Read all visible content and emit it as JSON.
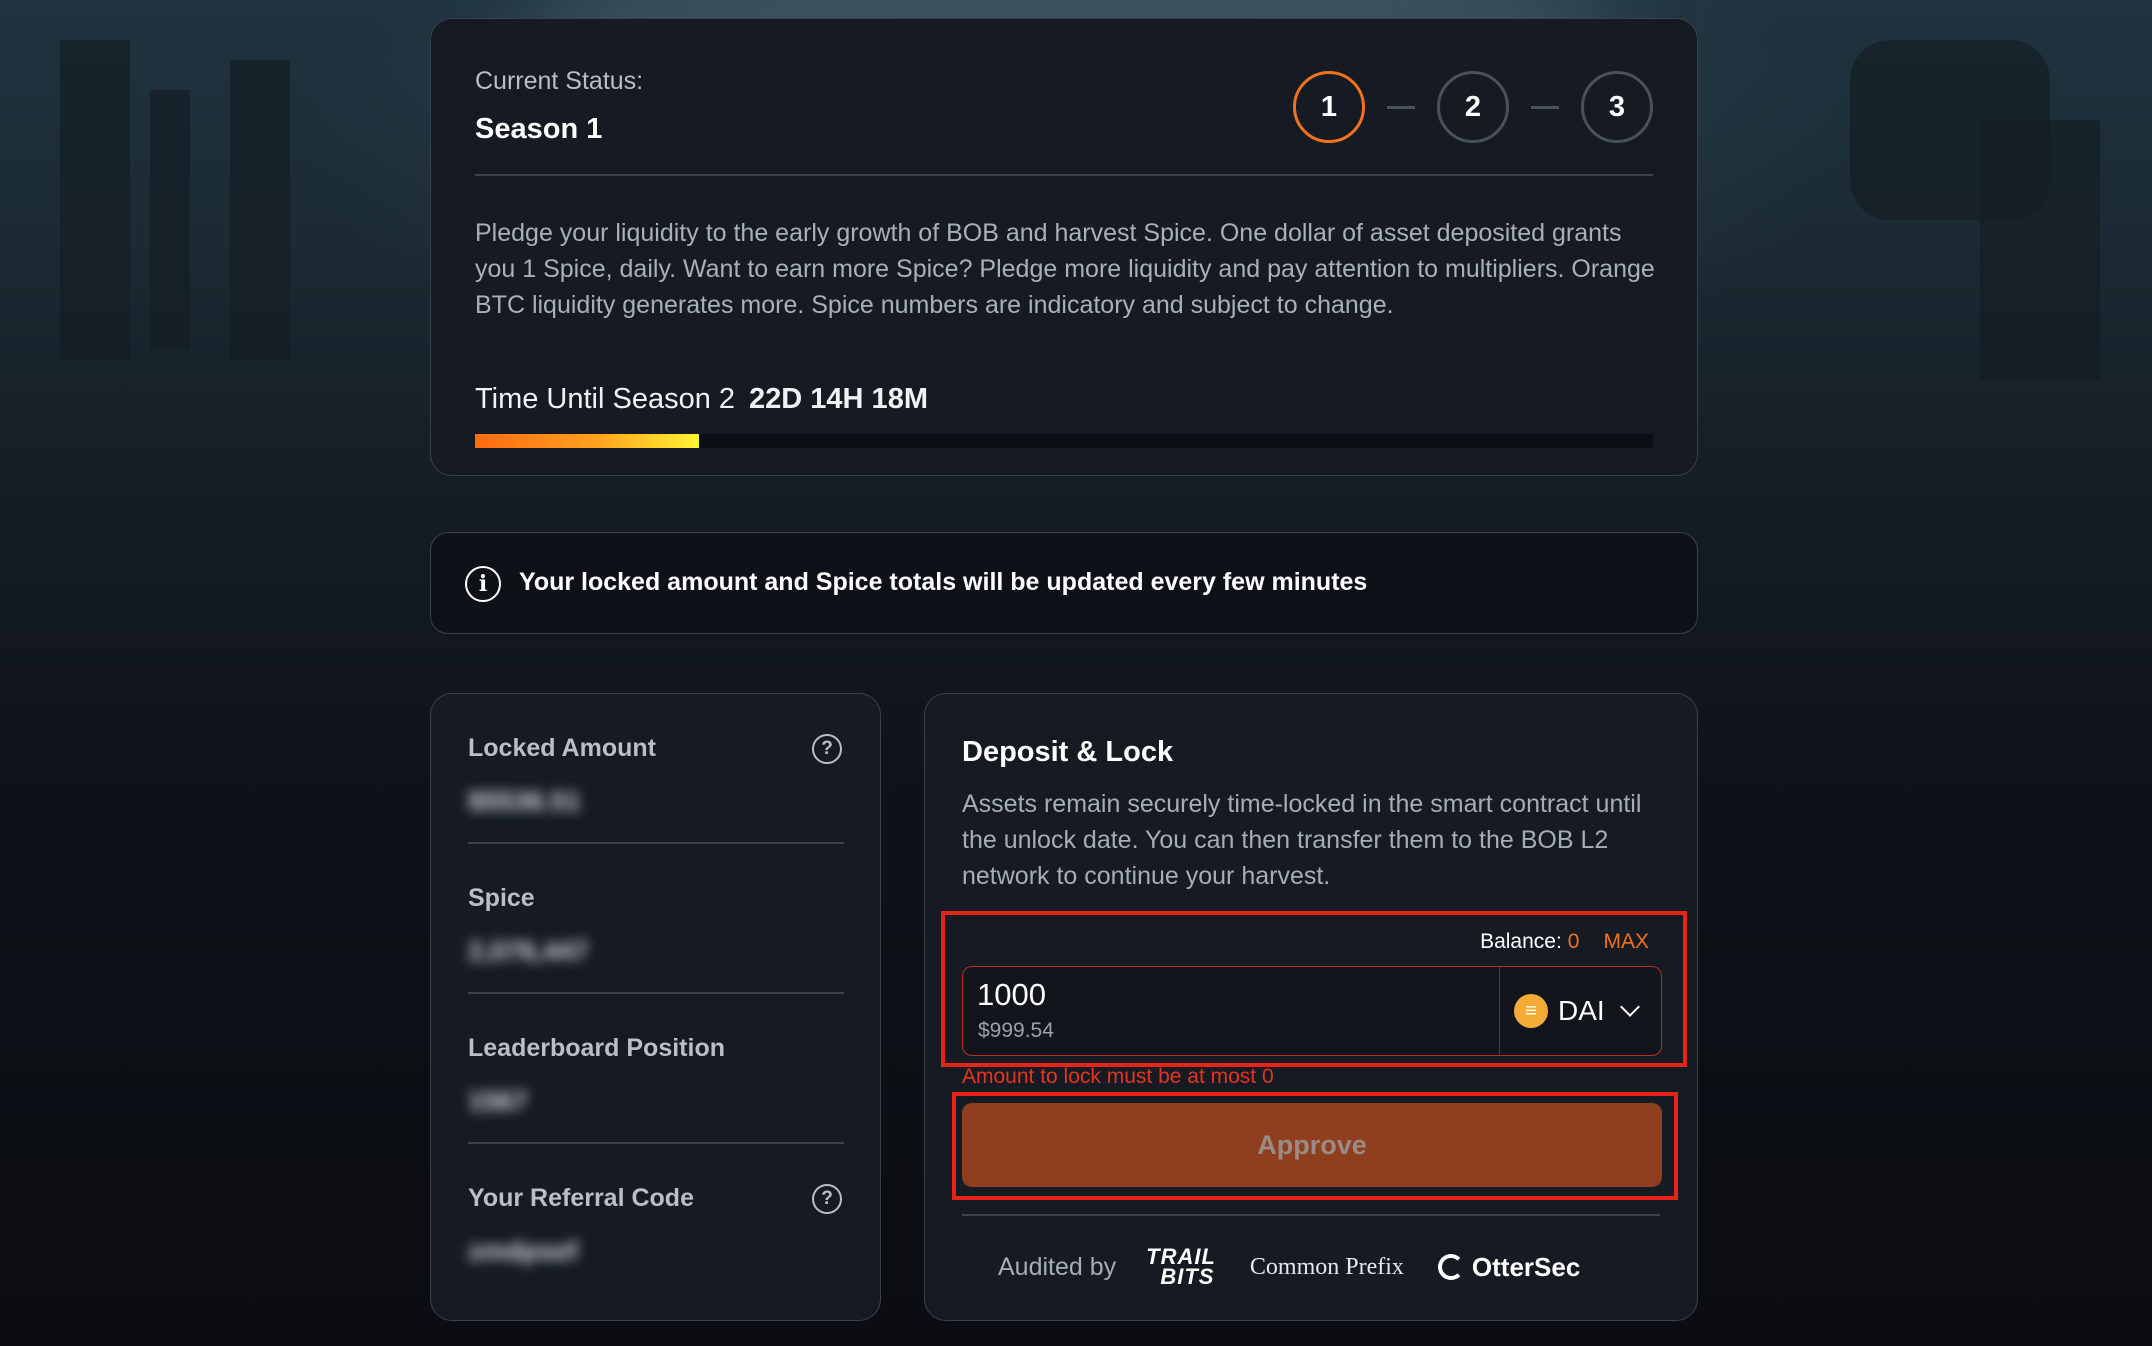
{
  "status": {
    "label": "Current Status:",
    "season": "Season 1",
    "steps": [
      "1",
      "2",
      "3"
    ],
    "active_step": "1",
    "description": "Pledge your liquidity to the early growth of BOB and harvest Spice. One dollar of asset deposited grants you 1 Spice, daily. Want to earn more Spice? Pledge more liquidity and pay attention to multipliers. Orange BTC liquidity generates more. Spice numbers are indicatory and subject to change.",
    "countdown_label": "Time Until Season 2",
    "countdown_value": "22D 14H 18M",
    "progress": 0.19
  },
  "info": {
    "icon": "info-icon",
    "text": "Your locked amount and Spice totals will be updated every few minutes"
  },
  "stats": [
    {
      "label": "Locked Amount",
      "value": "$5536.51",
      "help_icon": "question-icon"
    },
    {
      "label": "Spice",
      "value": "2,076,447"
    },
    {
      "label": "Leaderboard Position",
      "value": "1567"
    },
    {
      "label": "Your Referral Code",
      "value": "zmdpsef",
      "help_icon": "question-icon"
    }
  ],
  "deposit": {
    "title": "Deposit & Lock",
    "description": "Assets remain securely time-locked in the smart contract until the unlock date. You can then transfer them to the BOB L2 network to continue your harvest.",
    "balance_label": "Balance:",
    "balance_value": "0",
    "max_label": "MAX",
    "amount": "1000",
    "amount_usd": "$999.54",
    "token": "DAI",
    "error": "Amount to lock must be at most 0",
    "approve_label": "Approve",
    "audited_by": "Audited by",
    "auditors": [
      "TRAIL OF BITS",
      "Common Prefix",
      "OtterSec"
    ]
  },
  "colors": {
    "accent": "#f0721e",
    "error": "#e8231a",
    "approve_bg": "#8f3f1f",
    "card_bg": "#151a23"
  }
}
